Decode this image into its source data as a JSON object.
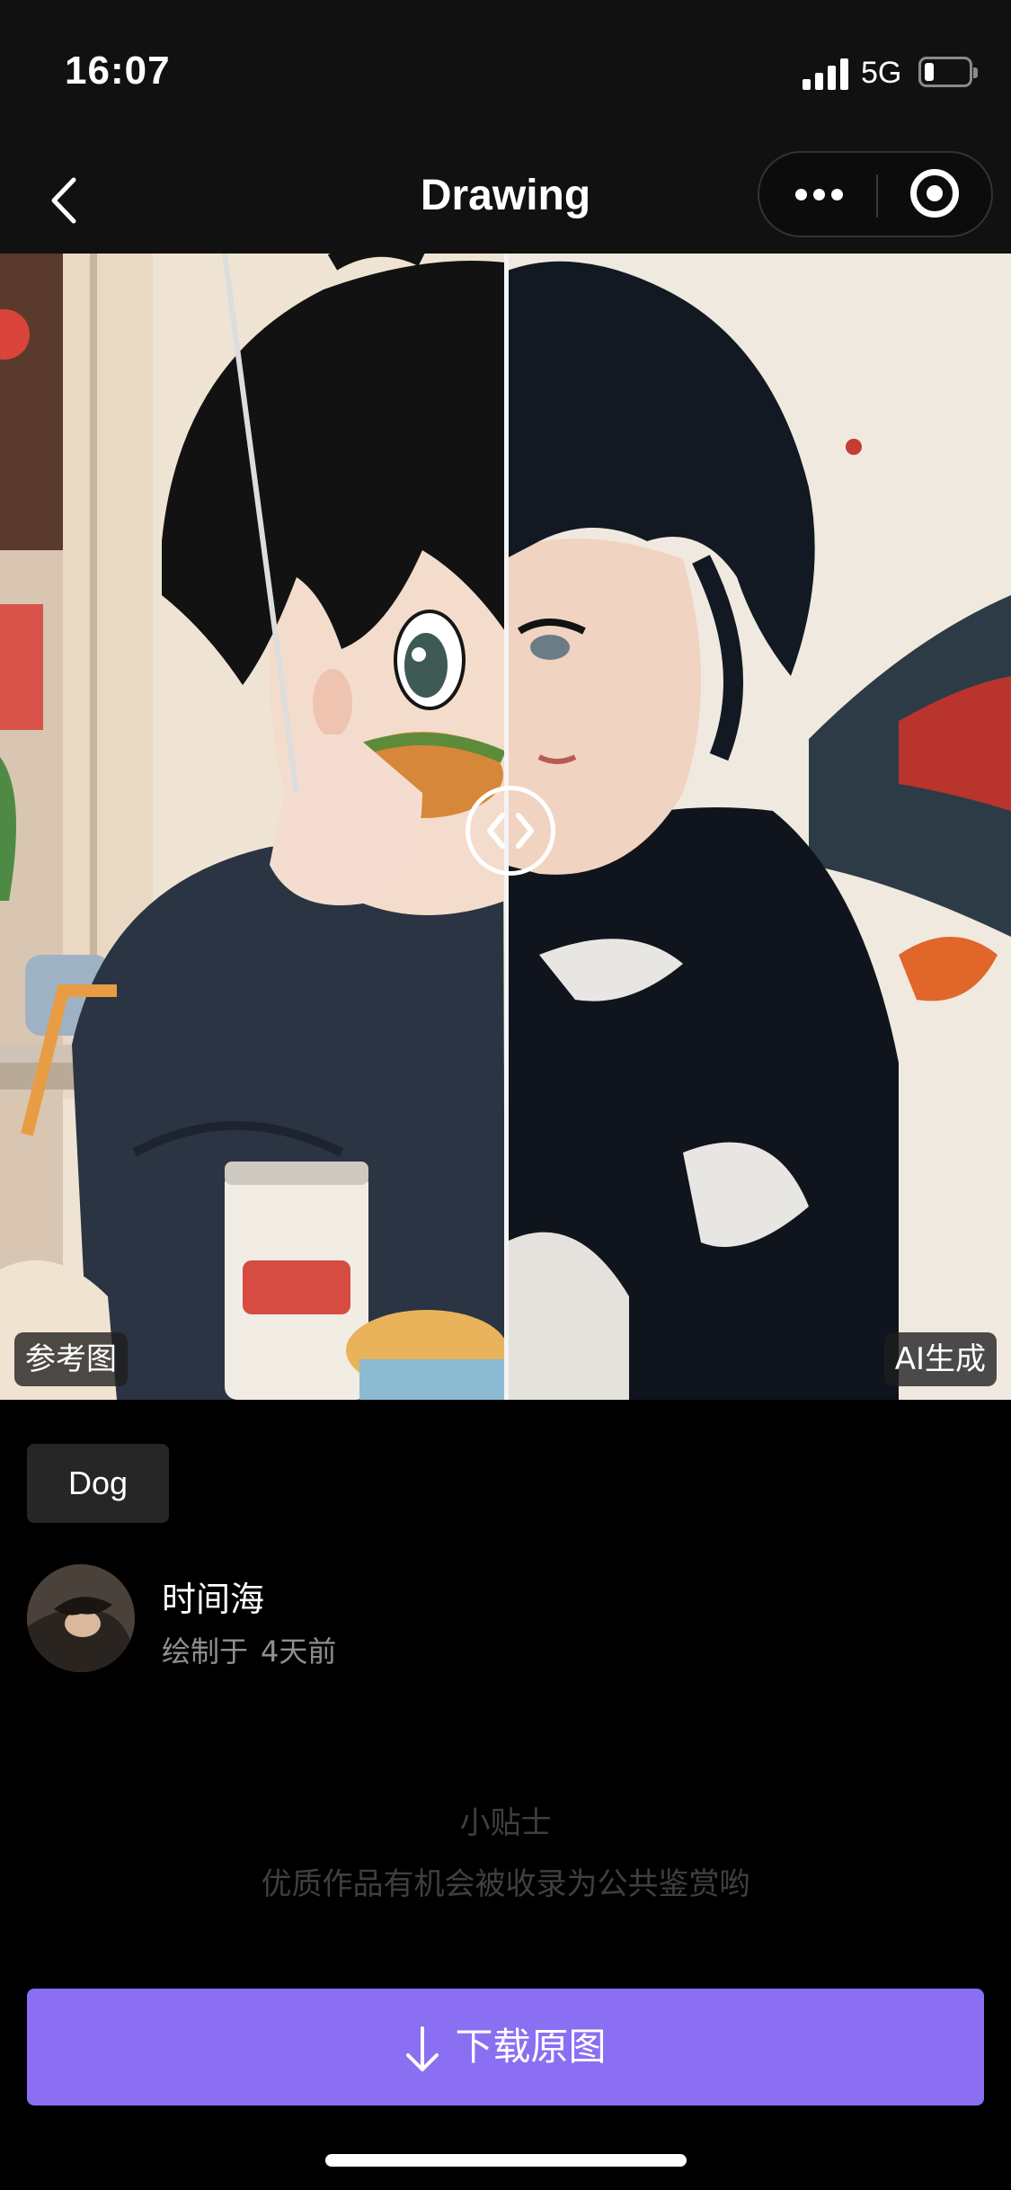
{
  "status_bar": {
    "time": "16:07",
    "network": "5G"
  },
  "nav": {
    "title": "Drawing"
  },
  "compare": {
    "left_label": "参考图",
    "right_label": "AI生成"
  },
  "tag": "Dog",
  "author": {
    "name": "时间海",
    "meta_prefix": "绘制于",
    "meta_time": "4天前"
  },
  "tips": {
    "title": "小贴士",
    "text": "优质作品有机会被收录为公共鉴赏哟"
  },
  "download": {
    "label": "下载原图"
  },
  "colors": {
    "accent": "#8a6ff2",
    "background": "#000000",
    "bar": "#111111"
  },
  "icons": [
    "back-icon",
    "more-icon",
    "target-icon",
    "compare-arrows-icon",
    "download-arrow-icon"
  ]
}
